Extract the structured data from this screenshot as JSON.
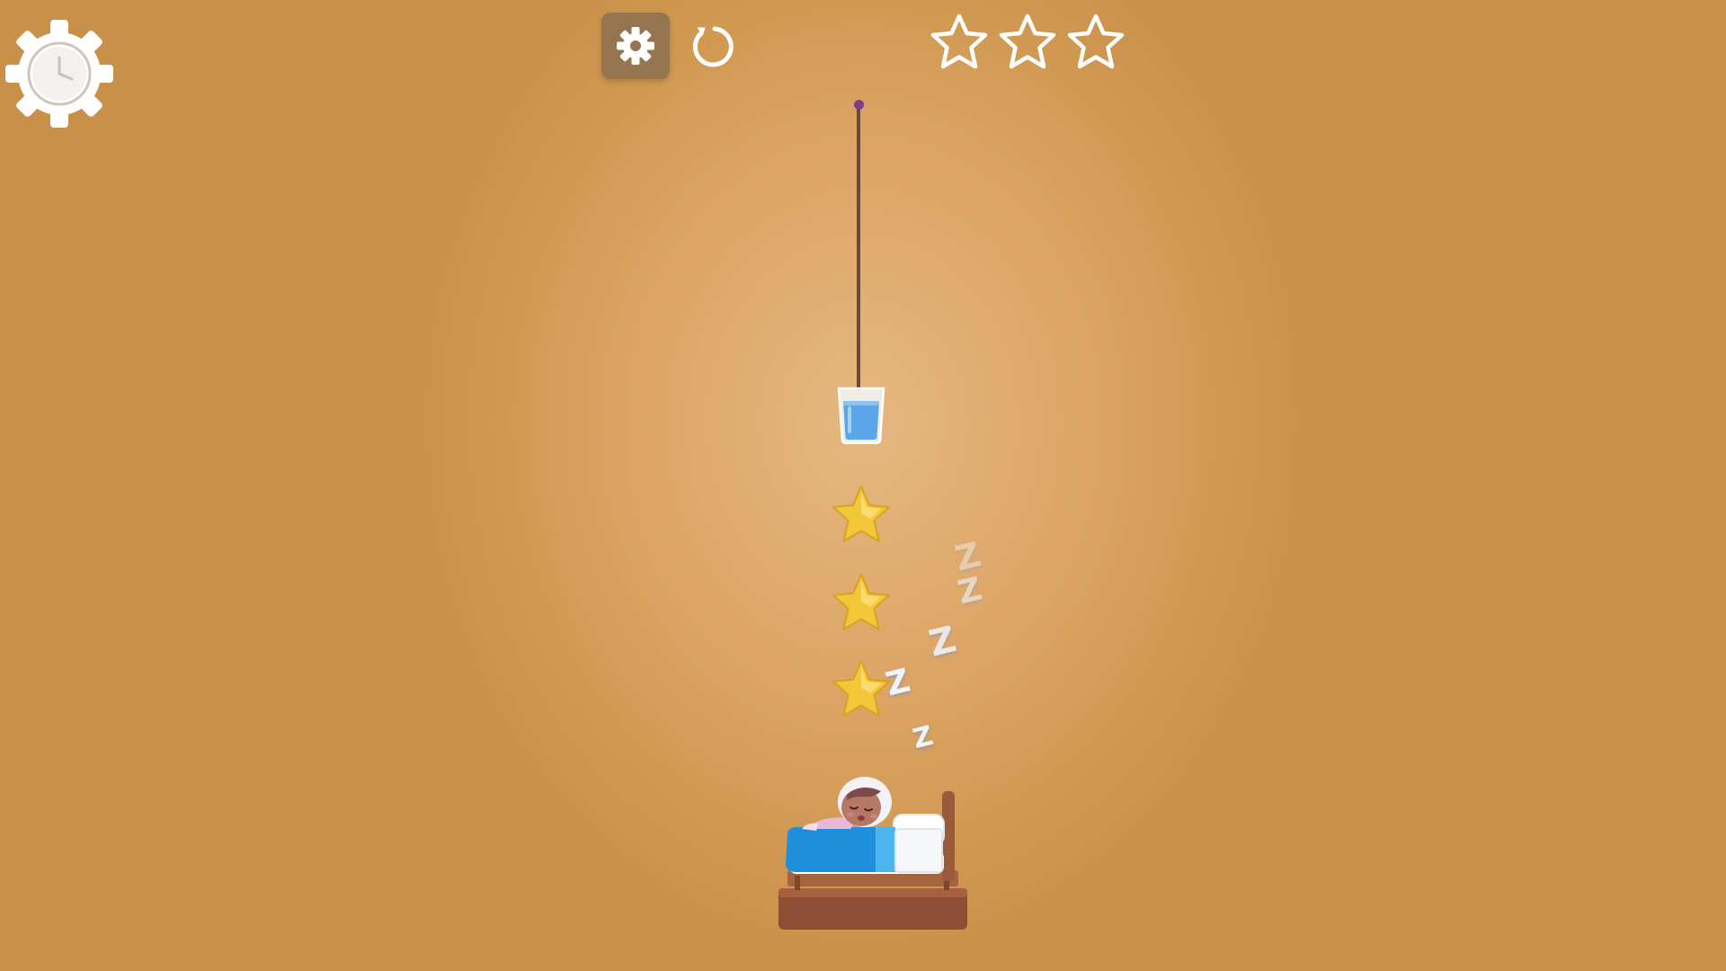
{
  "hud": {
    "gear_clock_icon": "gear-clock-icon",
    "settings_icon": "gear-icon",
    "restart_icon": "restart-icon",
    "rating_stars_earned": 0,
    "rating_stars_total": 3
  },
  "scene": {
    "objects": [
      "rope",
      "water-glass",
      "star",
      "star",
      "star",
      "sleeping-character-in-bed"
    ],
    "stars_remaining": 3,
    "sleep_text": "Z"
  },
  "colors": {
    "background": "#dda667",
    "settings_button": "#95754f",
    "water": "#5aa6e8",
    "blanket": "#1f8fdc",
    "bed_wood": "#9a5a3c",
    "star_gold": "#f3c73a"
  }
}
